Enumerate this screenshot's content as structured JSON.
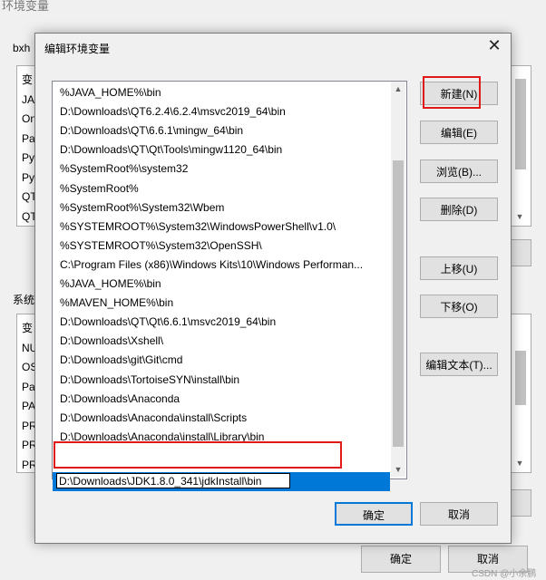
{
  "parent": {
    "title": "环境变量",
    "user_group": "bxh",
    "user_items": [
      "变",
      "JA",
      "On",
      "Pa",
      "Py",
      "Py",
      "QT",
      "QT"
    ],
    "system_group": "系统",
    "system_items": [
      "变",
      "NU",
      "OS",
      "Pa",
      "PA",
      "PR",
      "PR",
      "PR"
    ],
    "ok_label": "确定",
    "cancel_label": "取消"
  },
  "dialog": {
    "title": "编辑环境变量",
    "close_icon": "close-icon",
    "entries": [
      "%JAVA_HOME%\\bin",
      "D:\\Downloads\\QT6.2.4\\6.2.4\\msvc2019_64\\bin",
      "D:\\Downloads\\QT\\6.6.1\\mingw_64\\bin",
      "D:\\Downloads\\QT\\Qt\\Tools\\mingw1120_64\\bin",
      "%SystemRoot%\\system32",
      "%SystemRoot%",
      "%SystemRoot%\\System32\\Wbem",
      "%SYSTEMROOT%\\System32\\WindowsPowerShell\\v1.0\\",
      "%SYSTEMROOT%\\System32\\OpenSSH\\",
      "C:\\Program Files (x86)\\Windows Kits\\10\\Windows Performan...",
      "%JAVA_HOME%\\bin",
      "%MAVEN_HOME%\\bin",
      "D:\\Downloads\\QT\\Qt\\6.6.1\\msvc2019_64\\bin",
      "D:\\Downloads\\Xshell\\",
      "D:\\Downloads\\git\\Git\\cmd",
      "D:\\Downloads\\TortoiseSYN\\install\\bin",
      "D:\\Downloads\\Anaconda",
      "D:\\Downloads\\Anaconda\\install\\Scripts",
      "D:\\Downloads\\Anaconda\\install\\Library\\bin"
    ],
    "editing_value": "D:\\Downloads\\JDK1.8.0_341\\jdkInstall\\bin",
    "buttons": {
      "new": "新建(N)",
      "edit": "编辑(E)",
      "browse": "浏览(B)...",
      "delete": "删除(D)",
      "move_up": "上移(U)",
      "move_down": "下移(O)",
      "edit_text": "编辑文本(T)..."
    },
    "ok_label": "确定",
    "cancel_label": "取消"
  },
  "watermark": "CSDN @小余鹏"
}
